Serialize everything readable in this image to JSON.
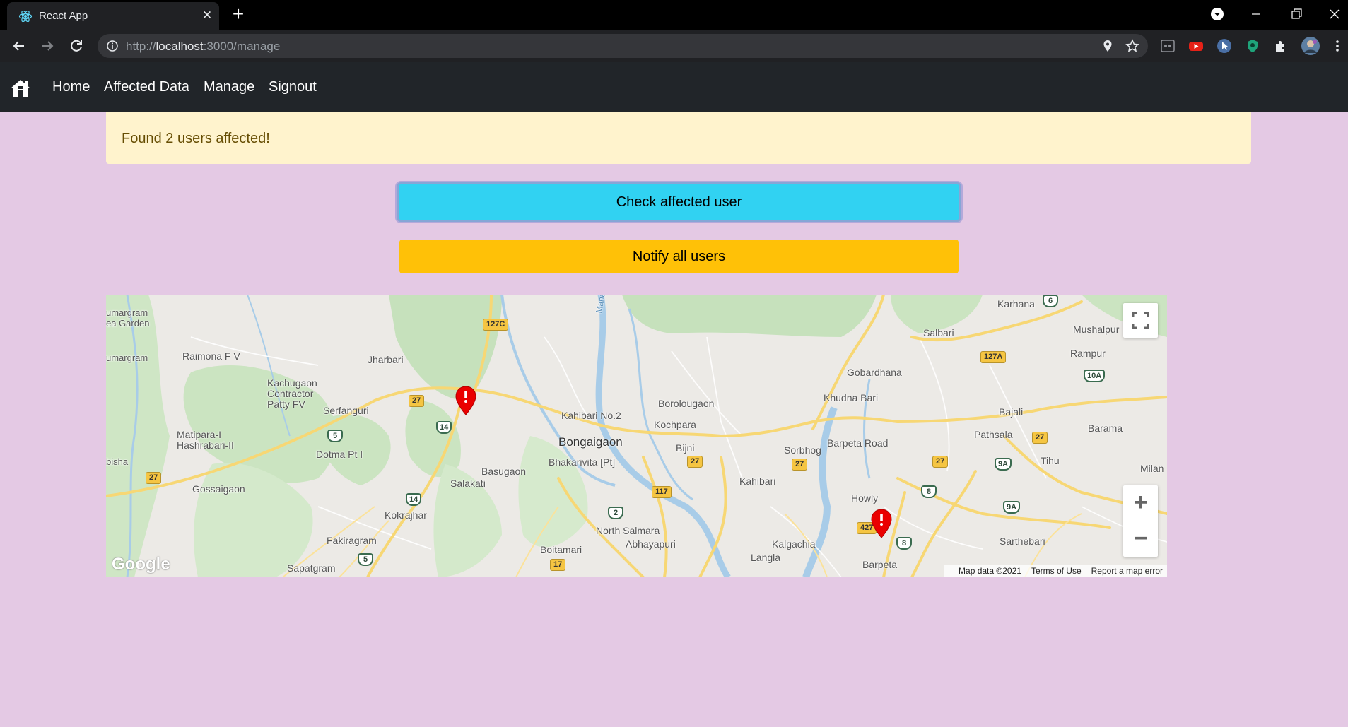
{
  "browser": {
    "tab_title": "React App",
    "url_host": "localhost",
    "url_prefix": "http://",
    "url_rest": ":3000/manage",
    "new_tab": "+",
    "tab_close": "✕"
  },
  "navbar": {
    "links": [
      "Home",
      "Affected Data",
      "Manage",
      "Signout"
    ]
  },
  "alert": {
    "text": "Found 2 users affected!"
  },
  "buttons": {
    "check": "Check affected user",
    "notify": "Notify all users"
  },
  "map": {
    "places": [
      "Karhana",
      "Salbari",
      "Mushalpur",
      "Rampur",
      "Raimona F V",
      "Jharbari",
      "Gobardhana",
      "Khudna Bari",
      "Kachugaon Contractor Patty FV",
      "Serfanguri",
      "Borolougaon",
      "Kahibari No.2",
      "Kochpara",
      "Bajali",
      "Matipara-I Hashrabari-II",
      "Bongaigaon",
      "Barpeta Road",
      "Pathsala",
      "Barama",
      "Dotma Pt I",
      "Bijni",
      "Sorbhog",
      "Basugaon",
      "Bhakarivita [Pt]",
      "Tihu",
      "Milan",
      "Salakati",
      "Kahibari",
      "Gossaigaon",
      "Howly",
      "Kokrajhar",
      "North Salmara",
      "Abhayapuri",
      "Kalgachia",
      "Fakiragram",
      "Boitamari",
      "Sarthebari",
      "Langla",
      "Barpeta",
      "Sapatgram",
      "Manas River",
      "umargram ea Garden",
      "umargram",
      "bisha"
    ],
    "road_shields": [
      "127C",
      "27",
      "14",
      "5",
      "27",
      "127A",
      "10A",
      "27",
      "9A",
      "27",
      "27",
      "117",
      "2",
      "27",
      "8",
      "9A",
      "14",
      "17",
      "8",
      "5",
      "6",
      "427"
    ],
    "google_logo": "Google",
    "attribution": {
      "data": "Map data ©2021",
      "terms": "Terms of Use",
      "report": "Report a map error"
    },
    "zoom_in": "+",
    "zoom_out": "−",
    "markers": 2
  },
  "colors": {
    "page_bg": "#e4c9e4",
    "navbar_bg": "#212529",
    "alert_bg": "#fff3cd",
    "alert_text": "#664d03",
    "info_button": "#31d2f2",
    "warning_button": "#ffc107",
    "marker": "#ea0000"
  }
}
